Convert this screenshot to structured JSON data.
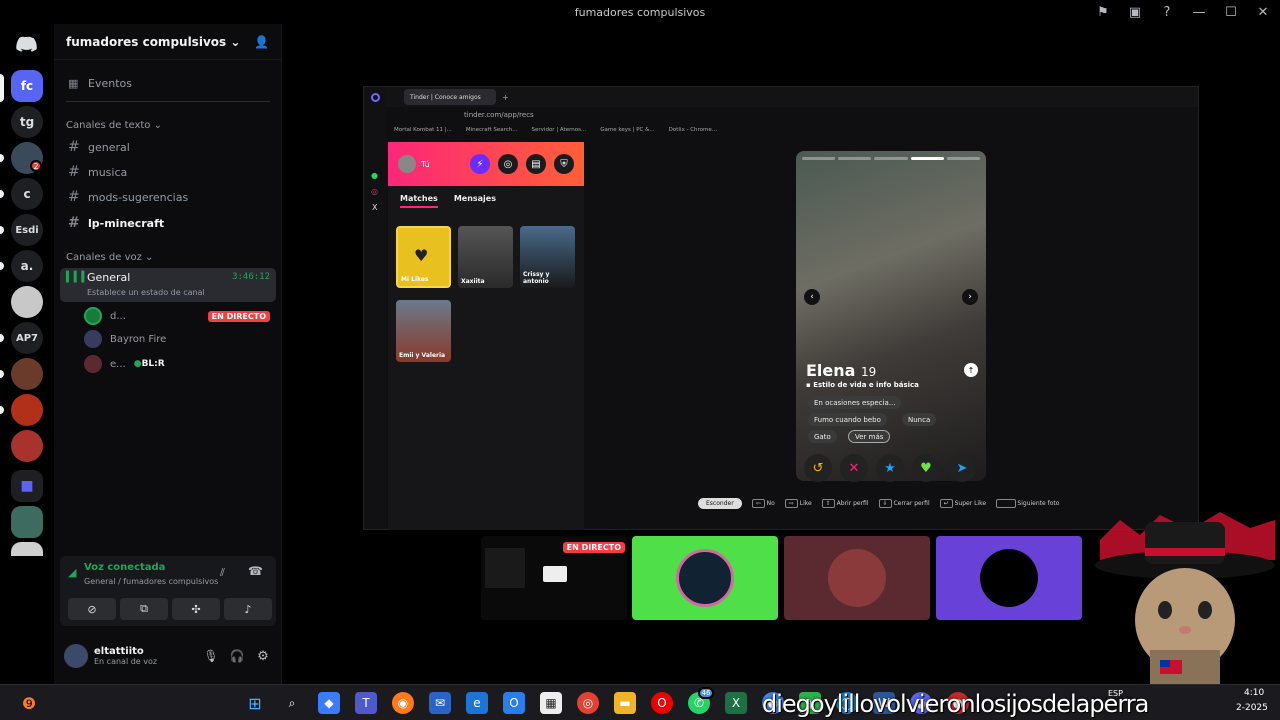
{
  "window": {
    "title": "fumadores compulsivos"
  },
  "rail": {
    "servers": [
      "fc",
      "tg",
      "c",
      "Esdi",
      "a.",
      "AP7"
    ],
    "badges": [
      "2"
    ]
  },
  "sidebar": {
    "server_name": "fumadores compulsivos",
    "events_label": "Eventos",
    "text_category": "Canales de texto",
    "text_channels": [
      "general",
      "musica",
      "mods-sugerencias",
      "lp-minecraft"
    ],
    "voice_category": "Canales de voz",
    "voice_channel": {
      "name": "General",
      "timer": "3:46:12",
      "status": "Establece un estado de canal"
    },
    "voice_users": [
      {
        "name": "d...",
        "live": "EN DIRECTO"
      },
      {
        "name": "Bayron Fire"
      },
      {
        "name": "e...",
        "tag": "BL:R"
      }
    ]
  },
  "voice_panel": {
    "title": "Voz conectada",
    "subtitle": "General / fumadores compulsivos"
  },
  "user_panel": {
    "username": "eltattiito",
    "status": "En canal de voz"
  },
  "browser": {
    "tab_label": "Tinder | Conoce amigos",
    "url": "tinder.com/app/recs",
    "bookmarks": [
      "Mortal Kombat 11 |...",
      "Minecraft Search...",
      "Servidor | Aternos...",
      "Game keys | PC &...",
      "Dotlix - Chrome..."
    ]
  },
  "tinder": {
    "user_label": "Tú",
    "tabs": [
      "Matches",
      "Mensajes"
    ],
    "matches": [
      "Mi Likes",
      "Xaxiita",
      "Crissy y antonio",
      "Emii y Valeria"
    ],
    "profile": {
      "name": "Elena",
      "age": "19",
      "section": "Estilo de vida e info básica",
      "chips": [
        "En ocasiones especia...",
        "Fumo cuando bebo",
        "Nunca",
        "Gato",
        "Ver más"
      ]
    },
    "hints": [
      "Esconder",
      "No",
      "Like",
      "Abrir perfil",
      "Cerrar perfil",
      "Super Like",
      "Siguiente foto"
    ]
  },
  "stage": {
    "live_badge": "EN DIRECTO"
  },
  "taskbar": {
    "lang": "ESP",
    "time": "4:10",
    "date": "2-2025",
    "notif_count": "46"
  },
  "overlay_text": "diegoylillovolvieronlosijosdelaperra",
  "colors": {
    "accent": "#5865f2",
    "live": "#f23f43",
    "tinder_start": "#fd267a",
    "tinder_end": "#ff6036",
    "voice_green": "#23a559"
  }
}
